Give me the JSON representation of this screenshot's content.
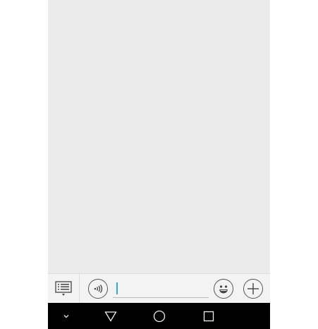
{
  "input": {
    "message_value": "",
    "message_placeholder": ""
  },
  "icons": {
    "menu": "list-menu-icon",
    "voice": "voice-input-icon",
    "emoji": "emoji-icon",
    "more": "plus-icon",
    "hide_nav": "chevron-down-icon",
    "back": "triangle-back-icon",
    "home": "circle-home-icon",
    "recents": "square-recents-icon"
  },
  "colors": {
    "chat_background": "#ebebeb",
    "cursor": "#2aa7e8",
    "nav_bar": "#000000"
  }
}
